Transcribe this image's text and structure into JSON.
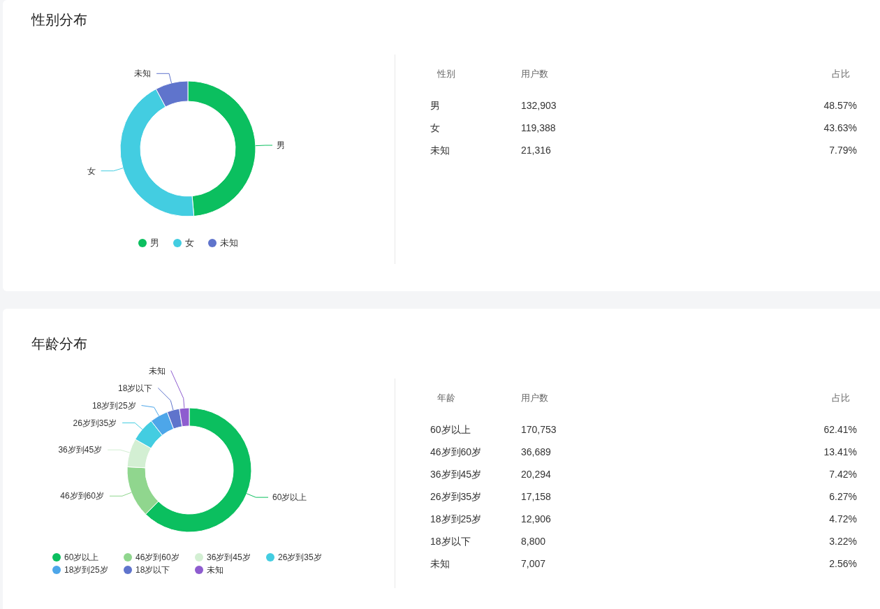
{
  "sections": [
    {
      "title": "性别分布",
      "chart": {
        "chart_data": {
          "type": "donut",
          "categories": [
            "男",
            "女",
            "未知"
          ],
          "values": [
            48.57,
            43.63,
            7.79
          ]
        },
        "legend": [
          {
            "label": "男",
            "color": "#0bbf5f"
          },
          {
            "label": "女",
            "color": "#43cde1"
          },
          {
            "label": "未知",
            "color": "#5f74cc"
          }
        ]
      },
      "table": {
        "columns": [
          "性别",
          "用户数",
          "占比"
        ],
        "rows": [
          [
            "男",
            "132,903",
            "48.57%"
          ],
          [
            "女",
            "119,388",
            "43.63%"
          ],
          [
            "未知",
            "21,316",
            "7.79%"
          ]
        ]
      }
    },
    {
      "title": "年龄分布",
      "chart": {
        "chart_data": {
          "type": "donut",
          "categories": [
            "60岁以上",
            "46岁到60岁",
            "36岁到45岁",
            "26岁到35岁",
            "18岁到25岁",
            "18岁以下",
            "未知"
          ],
          "values": [
            62.41,
            13.41,
            7.42,
            6.27,
            4.72,
            3.22,
            2.56
          ]
        },
        "legend": [
          {
            "label": "60岁以上",
            "color": "#0bbf5f"
          },
          {
            "label": "46岁到60岁",
            "color": "#90d68e"
          },
          {
            "label": "36岁到45岁",
            "color": "#d3efd3"
          },
          {
            "label": "26岁到35岁",
            "color": "#43cde1"
          },
          {
            "label": "18岁到25岁",
            "color": "#4da6e9"
          },
          {
            "label": "18岁以下",
            "color": "#5f74cc"
          },
          {
            "label": "未知",
            "color": "#8e5ccf"
          }
        ]
      },
      "table": {
        "columns": [
          "年龄",
          "用户数",
          "占比"
        ],
        "rows": [
          [
            "60岁以上",
            "170,753",
            "62.41%"
          ],
          [
            "46岁到60岁",
            "36,689",
            "13.41%"
          ],
          [
            "36岁到45岁",
            "20,294",
            "7.42%"
          ],
          [
            "26岁到35岁",
            "17,158",
            "6.27%"
          ],
          [
            "18岁到25岁",
            "12,906",
            "4.72%"
          ],
          [
            "18岁以下",
            "8,800",
            "3.22%"
          ],
          [
            "未知",
            "7,007",
            "2.56%"
          ]
        ]
      }
    }
  ]
}
